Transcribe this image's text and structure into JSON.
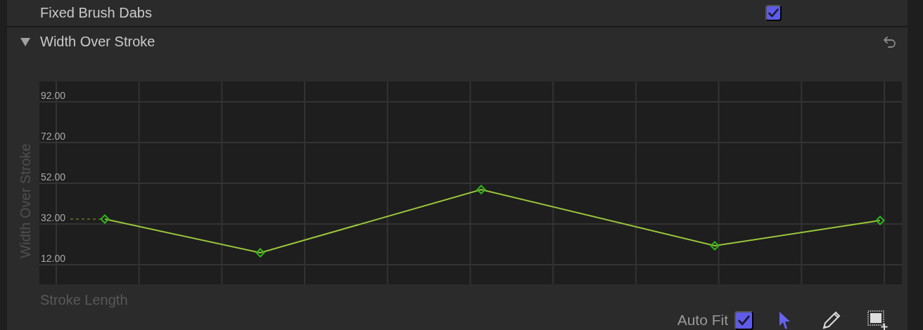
{
  "fixed_brush_dabs": {
    "label": "Fixed Brush Dabs",
    "checked": true
  },
  "section": {
    "title": "Width Over Stroke",
    "expanded": true,
    "graph": {
      "y_axis_label": "Width Over Stroke",
      "y_tick_labels": [
        "92.00",
        "72.00",
        "52.00",
        "32.00",
        "12.00"
      ],
      "x_axis_label": "Stroke Length"
    }
  },
  "auto_fit": {
    "label": "Auto Fit",
    "checked": true
  },
  "tools": [
    {
      "kind": "arrow",
      "selected": true
    },
    {
      "kind": "pencil",
      "selected": false
    },
    {
      "kind": "marquee",
      "selected": false
    }
  ]
}
